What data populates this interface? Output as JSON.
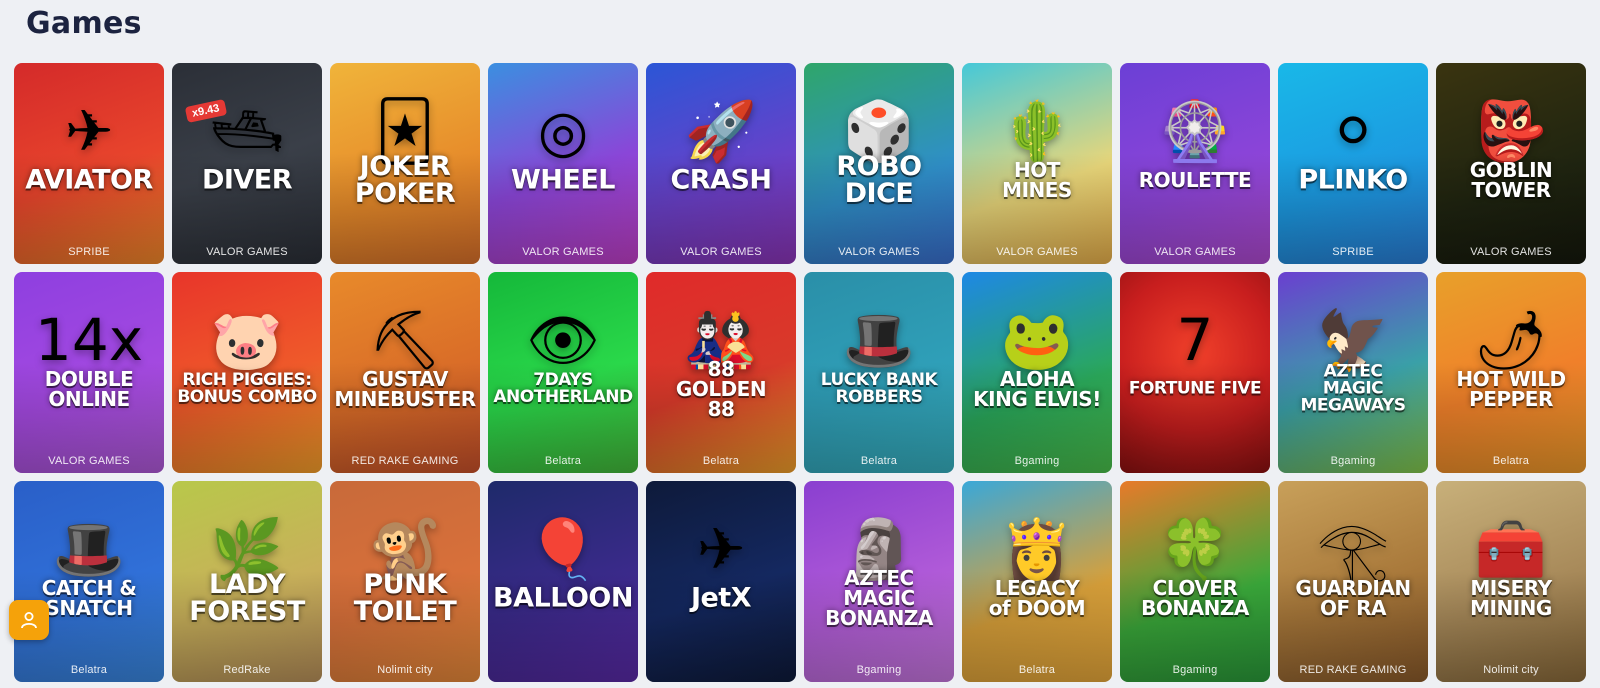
{
  "page": {
    "title": "Games"
  },
  "fab": {
    "icon": "user-icon"
  },
  "games": [
    {
      "name": "AVIATOR",
      "provider": "SPRIBE",
      "bg": "linear-gradient(160deg,#d42a2a 0%,#e8452c 55%,#f2892a 100%)",
      "art": "✈",
      "size": "",
      "boxed": false
    },
    {
      "name": "DIVER",
      "provider": "VALOR GAMES",
      "bg": "linear-gradient(160deg,#2b2f37 0%,#3a3f48 50%,#2b2f37 100%)",
      "art": "🛥",
      "size": "",
      "boxed": false,
      "badge": "x9.43"
    },
    {
      "name": "JOKER\nPOKER",
      "provider": "",
      "bg": "linear-gradient(160deg,#f0b43a 0%,#e68a2a 60%,#d9702a 100%)",
      "art": "🃏",
      "size": "",
      "boxed": false
    },
    {
      "name": "WHEEL",
      "provider": "VALOR GAMES",
      "bg": "linear-gradient(160deg,#3b8fe0 0%,#8a46d8 55%,#c23fc8 100%)",
      "art": "◎",
      "size": "",
      "boxed": false
    },
    {
      "name": "CRASH",
      "provider": "VALOR GAMES",
      "bg": "linear-gradient(160deg,#2b56d6 0%,#6b40c8 60%,#8c35b8 100%)",
      "art": "🚀",
      "size": "",
      "boxed": false
    },
    {
      "name": "ROBO\nDICE",
      "provider": "VALOR GAMES",
      "bg": "linear-gradient(160deg,#2fa66a 0%,#2f8fc8 60%,#3a6fd0 100%)",
      "art": "🎲",
      "size": "",
      "boxed": false
    },
    {
      "name": "HOT\nMINES",
      "provider": "VALOR GAMES",
      "bg": "linear-gradient(160deg,#45c8d8 0%,#e8d67a 60%,#e9b04a 100%)",
      "art": "🌵",
      "size": "small",
      "boxed": false
    },
    {
      "name": "ROULETTE",
      "provider": "VALOR GAMES",
      "bg": "linear-gradient(160deg,#6b3fd6 0%,#8e45d8 60%,#b04ad0 100%)",
      "art": "🎡",
      "size": "small",
      "boxed": false
    },
    {
      "name": "PLINKO",
      "provider": "SPRIBE",
      "bg": "linear-gradient(160deg,#19b8e8 0%,#1c98e0 60%,#2a7ed8 100%)",
      "art": "⚪",
      "size": "",
      "boxed": false
    },
    {
      "name": "GOBLIN\nTOWER",
      "provider": "VALOR GAMES",
      "bg": "linear-gradient(160deg,#3a3410 0%,#1f2410 60%,#15180c 100%)",
      "art": "👺",
      "size": "small",
      "boxed": false
    },
    {
      "name": "DOUBLE\nONLINE",
      "provider": "VALOR GAMES",
      "bg": "linear-gradient(160deg,#8e3fe0 0%,#a54ae0 60%,#b05ad8 100%)",
      "art": "14x",
      "size": "small",
      "boxed": false
    },
    {
      "name": "RICH PIGGIES:\nBONUS COMBO",
      "provider": "",
      "bg": "linear-gradient(160deg,#e8352a 0%,#ef5a2a 55%,#f6a02a 100%)",
      "art": "🐷",
      "size": "tiny",
      "boxed": false
    },
    {
      "name": "GUSTAV\nMINEBUSTER",
      "provider": "RED RAKE GAMING",
      "bg": "linear-gradient(160deg,#e88a2a 0%,#d86a28 60%,#c8502a 100%)",
      "art": "⛏",
      "size": "small",
      "boxed": false
    },
    {
      "name": "7DAYS\nANOTHERLAND",
      "provider": "Belatra",
      "bg": "linear-gradient(160deg,#15b83a 0%,#2ad84a 55%,#44b83a 100%)",
      "art": "👁",
      "size": "tiny",
      "boxed": false
    },
    {
      "name": "88\nGOLDEN\n88",
      "provider": "Belatra",
      "bg": "linear-gradient(160deg,#e02a2a 0%,#d83a2a 55%,#f0a02a 100%)",
      "art": "🎎",
      "size": "small",
      "boxed": false
    },
    {
      "name": "LUCKY BANK\nROBBERS",
      "provider": "Belatra",
      "bg": "linear-gradient(160deg,#2a8fa8 0%,#2f9fb8 55%,#36b0c0 100%)",
      "art": "🎩",
      "size": "tiny",
      "boxed": false
    },
    {
      "name": "ALOHA\nKING ELVIS!",
      "provider": "Bgaming",
      "bg": "linear-gradient(160deg,#1e88e5 0%,#2aa85a 60%,#4ac04a 100%)",
      "art": "🐸",
      "size": "small",
      "boxed": false
    },
    {
      "name": "FORTUNE FIVE",
      "provider": "",
      "bg": "radial-gradient(circle at 50% 40%,#f0402a 0%,#c81e1e 55%,#8a1010 100%)",
      "art": "7",
      "size": "tiny",
      "boxed": false
    },
    {
      "name": "AZTEC\nMAGIC\nMEGAWAYS",
      "provider": "Bgaming",
      "bg": "linear-gradient(160deg,#6a3fd0 0%,#3aa0a8 55%,#84c84a 100%)",
      "art": "🦅",
      "size": "tiny",
      "boxed": false
    },
    {
      "name": "HOT WILD\nPEPPER",
      "provider": "Belatra",
      "bg": "linear-gradient(160deg,#e8a02a 0%,#f0802a 55%,#ee9a2a 100%)",
      "art": "🌶",
      "size": "small",
      "boxed": false
    },
    {
      "name": "CATCH &\nSNATCH",
      "provider": "Belatra",
      "bg": "linear-gradient(160deg,#2a5fc8 0%,#3070d8 55%,#3a88e0 100%)",
      "art": "🎩",
      "size": "small",
      "boxed": false
    },
    {
      "name": "LADY\nFOREST",
      "provider": "RedRake",
      "bg": "linear-gradient(160deg,#b8c84a 0%,#c8b05a 55%,#b8905a 100%)",
      "art": "🌿",
      "size": "",
      "boxed": false
    },
    {
      "name": "PUNK\nTOILET",
      "provider": "Nolimit city",
      "bg": "linear-gradient(160deg,#c86a3a 0%,#d8703a 55%,#e88a3a 100%)",
      "art": "🐒",
      "size": "",
      "boxed": false
    },
    {
      "name": "BALLOON",
      "provider": "",
      "bg": "linear-gradient(160deg,#1e2a6a 0%,#3a2a8a 55%,#5a2aa8 100%)",
      "art": "🎈",
      "size": "",
      "boxed": false
    },
    {
      "name": "JetX",
      "provider": "",
      "bg": "linear-gradient(160deg,#0e1a3a 0%,#142860 55%,#0e1a3a 100%)",
      "art": "✈",
      "size": "",
      "boxed": false
    },
    {
      "name": "AZTEC\nMAGIC\nBONANZA",
      "provider": "Bgaming",
      "bg": "linear-gradient(160deg,#8a3fd0 0%,#b05ad8 55%,#c878e0 100%)",
      "art": "🗿",
      "size": "small",
      "boxed": false
    },
    {
      "name": "LEGACY\nof DOOM",
      "provider": "Belatra",
      "bg": "linear-gradient(160deg,#3aa8d8 0%,#d8a03a 60%,#e8a83a 100%)",
      "art": "👸",
      "size": "small",
      "boxed": false
    },
    {
      "name": "CLOVER\nBONANZA",
      "provider": "Bgaming",
      "bg": "linear-gradient(160deg,#e87a2a 0%,#3aa83a 60%,#2a9a3a 100%)",
      "art": "🍀",
      "size": "small",
      "boxed": false
    },
    {
      "name": "GUARDIAN\nOF RA",
      "provider": "RED RAKE GAMING",
      "bg": "linear-gradient(160deg,#c8a05a 0%,#a8783a 55%,#8a5a2a 100%)",
      "art": "𓂀",
      "size": "small",
      "boxed": false
    },
    {
      "name": "MISERY\nMINING",
      "provider": "Nolimit city",
      "bg": "linear-gradient(160deg,#c8b07a 0%,#a88a5a 55%,#8a6a3a 100%)",
      "art": "🧰",
      "size": "small",
      "boxed": false
    }
  ]
}
